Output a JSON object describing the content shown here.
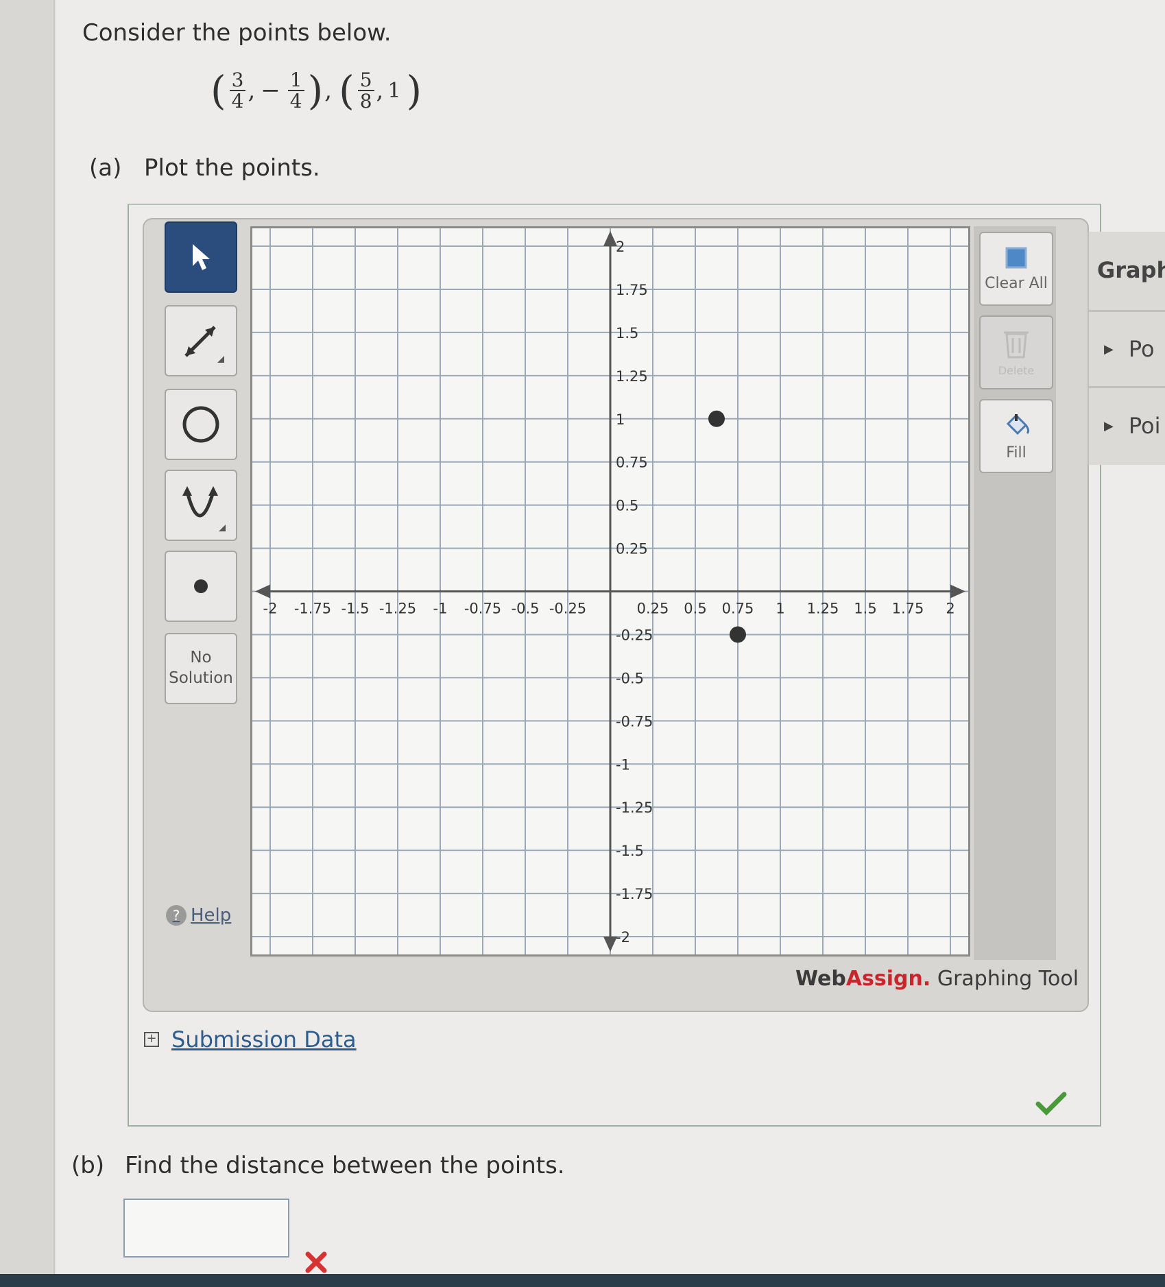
{
  "question": {
    "prompt": "Consider the points below.",
    "points": {
      "p1": {
        "x_num": "3",
        "x_den": "4",
        "y_sign": "−",
        "y_num": "1",
        "y_den": "4"
      },
      "p2": {
        "x_num": "5",
        "x_den": "8",
        "y": "1"
      },
      "separator": ","
    },
    "part_a": {
      "label": "(a)",
      "text": "Plot the points."
    },
    "part_b": {
      "label": "(b)",
      "text": "Find the distance between the points."
    }
  },
  "toolbar": {
    "tools": [
      "select",
      "line",
      "circle",
      "parabola",
      "point"
    ],
    "no_solution_line1": "No",
    "no_solution_line2": "Solution",
    "help_label": "Help"
  },
  "right_toolbar": {
    "clear_all_label": "Clear All",
    "delete_label": "Delete",
    "fill_label": "Fill"
  },
  "graph": {
    "x_range": [
      -2,
      2
    ],
    "y_range": [
      -2,
      2
    ],
    "tick_step": 0.25,
    "x_tick_labels": [
      "-2",
      "-1.75",
      "-1.5",
      "-1.25",
      "-1",
      "-0.75",
      "-0.5",
      "-0.25",
      "0.25",
      "0.5",
      "0.75",
      "1",
      "1.25",
      "1.5",
      "1.75",
      "2"
    ],
    "x_tick_values": [
      -2,
      -1.75,
      -1.5,
      -1.25,
      -1,
      -0.75,
      -0.5,
      -0.25,
      0.25,
      0.5,
      0.75,
      1,
      1.25,
      1.5,
      1.75,
      2
    ],
    "y_tick_labels": [
      "2",
      "1.75",
      "1.5",
      "1.25",
      "1",
      "0.75",
      "0.5",
      "0.25",
      "-0.25",
      "-0.5",
      "-0.75",
      "-1",
      "-1.25",
      "-1.5",
      "-1.75",
      "-2"
    ],
    "y_tick_values": [
      2,
      1.75,
      1.5,
      1.25,
      1,
      0.75,
      0.5,
      0.25,
      -0.25,
      -0.5,
      -0.75,
      -1,
      -1.25,
      -1.5,
      -1.75,
      -2
    ],
    "plotted_points": [
      {
        "x": 0.625,
        "y": 1
      },
      {
        "x": 0.75,
        "y": -0.25
      }
    ]
  },
  "brand": {
    "name_part1": "Web",
    "name_part2": "Assign.",
    "suffix": " Graphing Tool"
  },
  "side_panel": {
    "title": "Graph",
    "item1": "Po",
    "item2": "Poi"
  },
  "submission": {
    "label": "Submission Data",
    "expand_symbol": "+"
  },
  "answer": {
    "value": ""
  },
  "colors": {
    "accent": "#2a4d7d",
    "brand_red": "#c8252c",
    "correct": "#4a9a3a",
    "incorrect": "#d63333"
  }
}
